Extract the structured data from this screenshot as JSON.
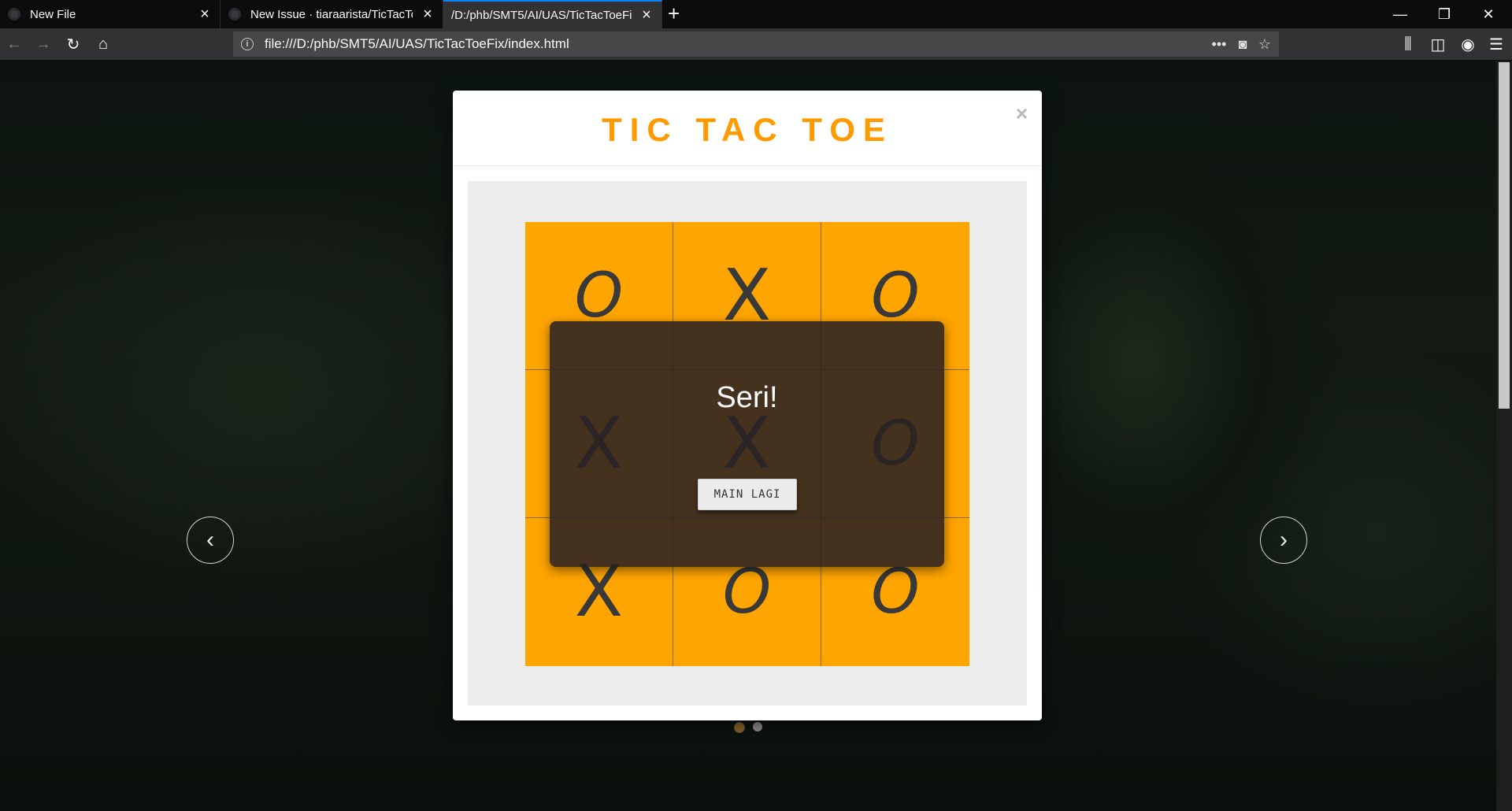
{
  "browser": {
    "tabs": [
      {
        "label": "New File",
        "active": false
      },
      {
        "label": "New Issue · tiaraarista/TicTacTo",
        "active": false
      },
      {
        "label": "/D:/phb/SMT5/AI/UAS/TicTacToeFi",
        "active": true
      }
    ],
    "new_tab_symbol": "+",
    "url": "file:///D:/phb/SMT5/AI/UAS/TicTacToeFix/index.html",
    "window_controls": {
      "minimize": "—",
      "restore": "❐",
      "close": "✕"
    },
    "nav": {
      "back": "←",
      "forward": "→",
      "reload": "↻",
      "home": "⌂"
    },
    "url_actions": {
      "more": "•••",
      "pocket": "◙",
      "bookmark": "☆"
    },
    "toolbar": {
      "library": "⫼",
      "sidebar": "◫",
      "account": "◉",
      "menu": "☰"
    }
  },
  "game": {
    "title": "TIC TAC TOE",
    "close_symbol": "×",
    "board": [
      "O",
      "X",
      "O",
      "X",
      "X",
      "O",
      "X",
      "O",
      "O"
    ],
    "result_text": "Seri!",
    "replay_label": "MAIN LAGI",
    "accent": "#ffa500"
  },
  "carousel": {
    "prev_symbol": "‹",
    "next_symbol": "›",
    "indicators": 2,
    "active_indicator": 1
  }
}
